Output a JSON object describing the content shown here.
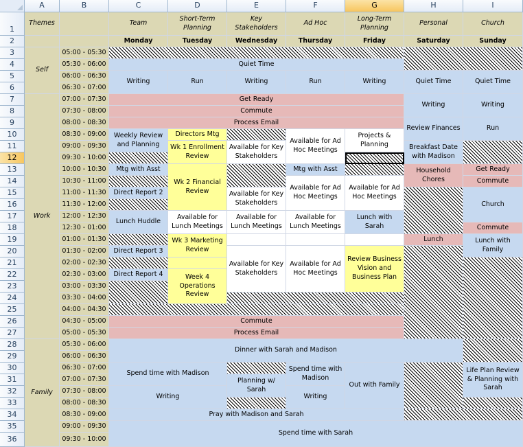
{
  "columns": [
    "A",
    "B",
    "C",
    "D",
    "E",
    "F",
    "G",
    "H",
    "I"
  ],
  "row_numbers": [
    "1",
    "2",
    "3",
    "4",
    "5",
    "6",
    "7",
    "8",
    "9",
    "10",
    "11",
    "12",
    "13",
    "14",
    "15",
    "16",
    "17",
    "18",
    "19",
    "20",
    "21",
    "22",
    "23",
    "24",
    "25",
    "26",
    "27",
    "28",
    "29",
    "30",
    "31",
    "32",
    "33",
    "34",
    "35",
    "36"
  ],
  "selection": {
    "column": "G",
    "row": "12"
  },
  "header": {
    "themes_label": "Themes",
    "topics": [
      "Team",
      "Short-Term Planning",
      "Key Stakeholders",
      "Ad Hoc",
      "Long-Term Planning",
      "Personal",
      "Church"
    ],
    "days": [
      "Monday",
      "Tuesday",
      "Wednesday",
      "Thursday",
      "Friday",
      "Saturday",
      "Sunday"
    ]
  },
  "times": [
    "05:00 - 05:30",
    "05:30 - 06:00",
    "06:00 - 06:30",
    "06:30 - 07:00",
    "07:00 - 07:30",
    "07:30 - 08:00",
    "08:00 - 08:30",
    "08:30 - 09:00",
    "09:00 - 09:30",
    "09:30 - 10:00",
    "10:00 - 10:30",
    "10:30 - 11:00",
    "11:00 - 11:30",
    "11:30 - 12:00",
    "12:00 - 12:30",
    "12:30 - 01:00",
    "01:00 - 01:30",
    "01:30 - 02:00",
    "02:00 - 02:30",
    "02:30 - 03:00",
    "03:00 - 03:30",
    "03:30 - 04:00",
    "04:00 - 04:30",
    "04:30 - 05:00",
    "05:00 - 05:30",
    "05:30 - 06:00",
    "06:00 - 06:30",
    "06:30 - 07:00",
    "07:00 - 07:30",
    "07:30 - 08:00",
    "08:00 - 08:30",
    "08:30 - 09:00",
    "09:00 - 09:30",
    "09:30 - 10:00"
  ],
  "themes": [
    "Self",
    "Work",
    "Family"
  ],
  "blocks": [
    "Quiet Time",
    "Writing",
    "Run",
    "Writing",
    "Run",
    "Writing",
    "Quiet Time",
    "Quiet Time",
    "Get Ready",
    "Commute",
    "Process Email",
    "Writing",
    "Writing",
    "Review Finances",
    "Run",
    "Weekly Review and Planning",
    "Directors Mtg",
    "Wk 1 Enrollment Review",
    "Available for Ad Hoc Meetings",
    "Projects & Planning",
    "Available for Key Stakeholders",
    "Breakfast Date with Madison",
    "Mtg with Asst",
    "Mtg with Asst",
    "Household Chores",
    "Get Ready",
    "Commute",
    "Wk 2 Financial Review",
    "Available for Ad Hoc Meetings",
    "Available for Ad Hoc Meetings",
    "Direct Report 2",
    "Available for Key Stakeholders",
    "Church",
    "Lunch Huddle",
    "Available for Lunch Meetings",
    "Available for Lunch Meetings",
    "Available for Lunch Meetings",
    "Lunch with Sarah",
    "Commute",
    "Lunch",
    "Lunch with Family",
    "Wk 3 Marketing Review",
    "Direct Report 3",
    "Available for Key Stakeholders",
    "Available  for Ad Hoc Meetings",
    "Review Business Vision and Business Plan",
    "Direct Report 4",
    "Week 4 Operations Review",
    "Commute",
    "Process Email",
    "Dinner with Sarah and Madison",
    "Spend time with Madison",
    "Spend time with Madison",
    "Planning w/ Sarah",
    "Out with Family",
    "Life Plan Review & Planning with Sarah",
    "Writing",
    "Writing",
    "Pray with Madison and Sarah",
    "Spend time with Sarah"
  ]
}
